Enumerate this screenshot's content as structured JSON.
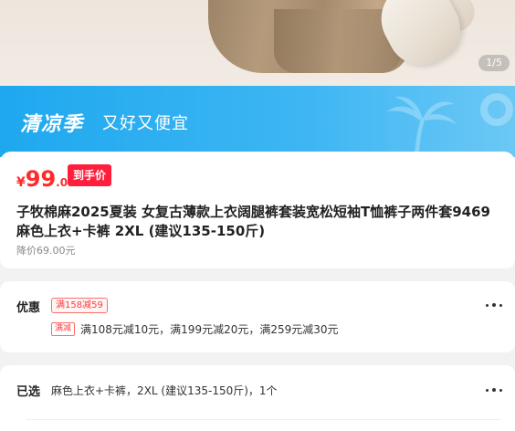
{
  "gallery": {
    "indicator": "1/5"
  },
  "banner": {
    "title": "清凉季",
    "subtitle": "又好又便宜"
  },
  "price": {
    "currency": "¥",
    "integer": "99",
    "decimal": ".00",
    "tag": "到手价",
    "original": "降价69.00元"
  },
  "product": {
    "title": "子牧棉麻2025夏装 女复古薄款上衣阔腿裤套装宽松短袖T恤裤子两件套9469 麻色上衣+卡裤 2XL (建议135-150斤)"
  },
  "offers": {
    "label": "优惠",
    "coupon": "满158减59",
    "promo_badge": "满减",
    "promo_text": "满108元减10元，满199元减20元，满259元减30元"
  },
  "selected": {
    "label": "已选",
    "text": "麻色上衣+卡裤，2XL (建议135-150斤)，1个"
  },
  "colors": {
    "price_red": "#ff2a2a",
    "banner_blue": "#1fa8ef",
    "tag_red": "#ff1f3d"
  },
  "icons": [
    "palm-tree-icon",
    "swim-ring-icon",
    "more-dots-icon"
  ]
}
